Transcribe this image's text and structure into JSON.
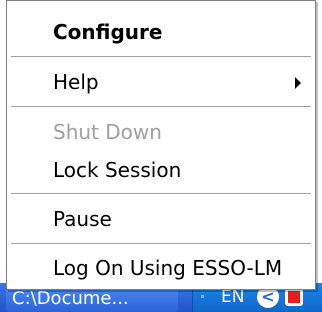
{
  "menu": {
    "items": [
      {
        "label": "Configure",
        "style": "bold",
        "enabled": true
      },
      {
        "label": "Help",
        "has_submenu": true,
        "enabled": true
      },
      {
        "label": "Shut Down",
        "enabled": false
      },
      {
        "label": "Lock Session",
        "enabled": true
      },
      {
        "label": "Pause",
        "enabled": true
      },
      {
        "label": "Log On Using ESSO-LM",
        "enabled": true
      }
    ]
  },
  "taskbar": {
    "task_button_label": "C:\\Docume...",
    "language": "EN",
    "tray_arrow": "<"
  },
  "colors": {
    "taskbar": "#2153c6",
    "tray": "#0f66c8",
    "disabled_text": "#a0a0a0",
    "tray_app_icon": "#e02020"
  },
  "icons": [
    "submenu-arrow-icon",
    "tray-expand-arrow-icon",
    "tray-app-icon"
  ]
}
